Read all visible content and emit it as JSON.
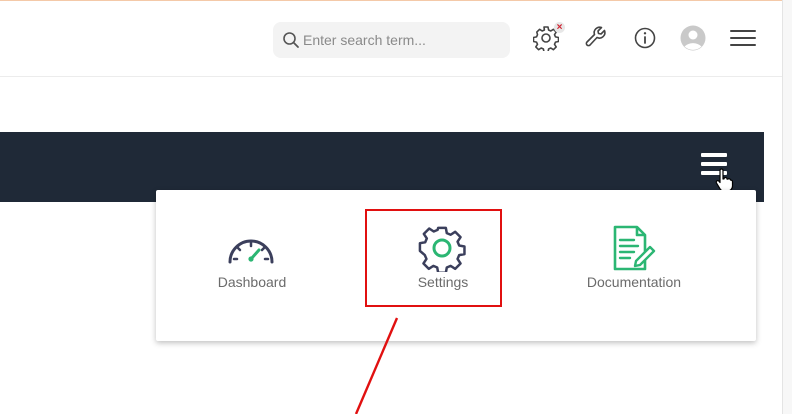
{
  "search": {
    "placeholder": "Enter search term..."
  },
  "header_icons": [
    "settings-icon",
    "wrench-icon",
    "info-icon",
    "avatar-icon",
    "menu-icon"
  ],
  "notification_badge": "×",
  "dropdown": {
    "items": [
      {
        "label": "Dashboard",
        "icon": "speedometer-icon"
      },
      {
        "label": "Settings",
        "icon": "gear-icon"
      },
      {
        "label": "Documentation",
        "icon": "document-edit-icon"
      }
    ]
  },
  "colors": {
    "darkbar": "#1f2937",
    "accent_green": "#2bb673",
    "icon_dark": "#3b3f5c",
    "annotation_red": "#e11010"
  }
}
